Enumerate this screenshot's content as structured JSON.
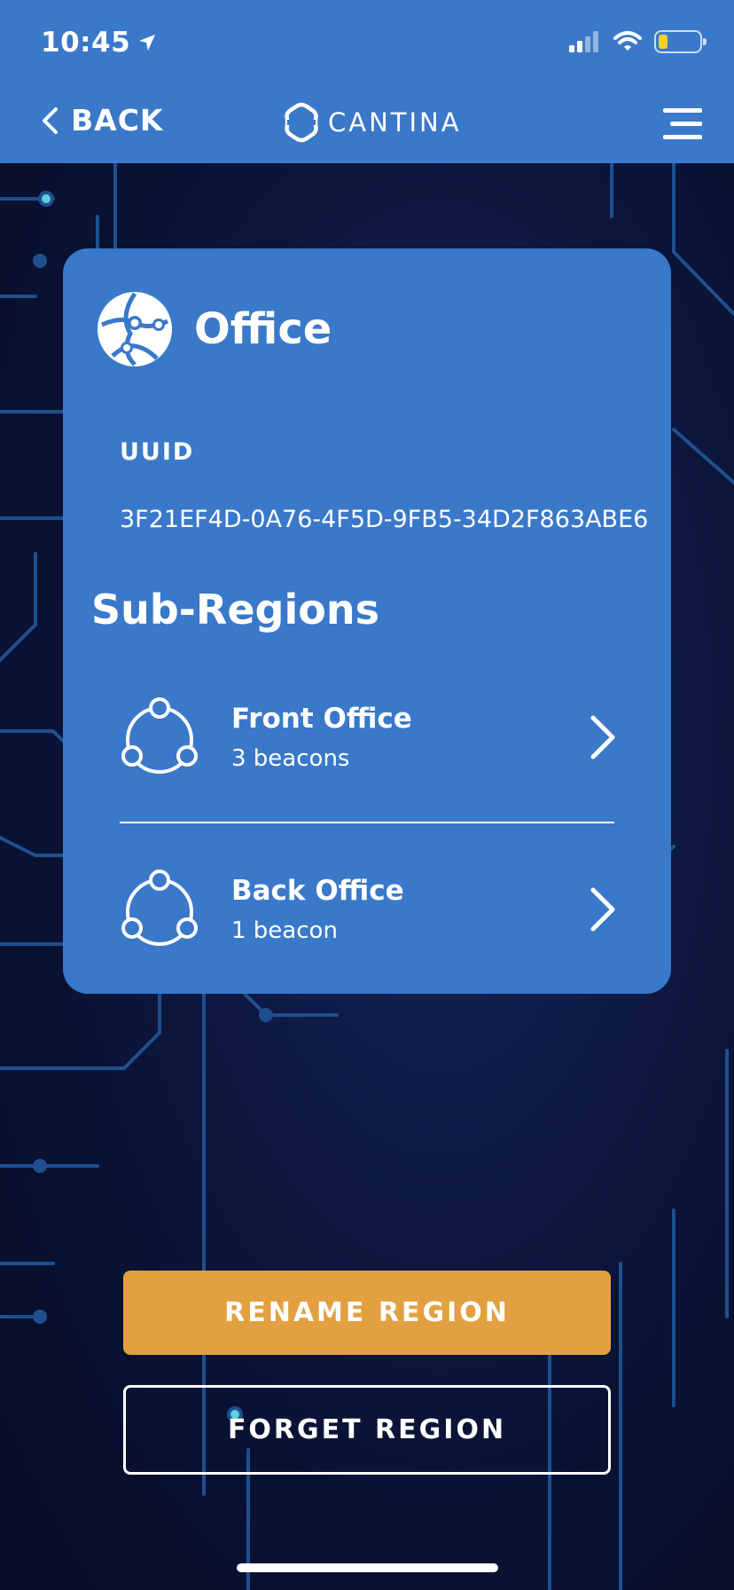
{
  "status_bar": {
    "time": "10:45",
    "icons": [
      "location-arrow-icon",
      "signal-icon",
      "wifi-icon",
      "battery-icon"
    ],
    "battery_color": "#f2d024"
  },
  "nav": {
    "back_label": "BACK",
    "brand": "CANTINA",
    "menu_icon": "hamburger-menu-icon"
  },
  "region": {
    "name": "Office",
    "uuid_label": "UUID",
    "uuid": "3F21EF4D-0A76-4F5D-9FB5-34D2F863ABE6"
  },
  "sub_regions": {
    "title": "Sub-Regions",
    "items": [
      {
        "name": "Front Office",
        "count": "3 beacons"
      },
      {
        "name": "Back Office",
        "count": "1 beacon"
      }
    ]
  },
  "actions": {
    "rename_label": "RENAME REGION",
    "forget_label": "FORGET REGION"
  },
  "colors": {
    "primary": "#3a78c9",
    "accent": "#e2a040",
    "background": "#0a1330"
  }
}
